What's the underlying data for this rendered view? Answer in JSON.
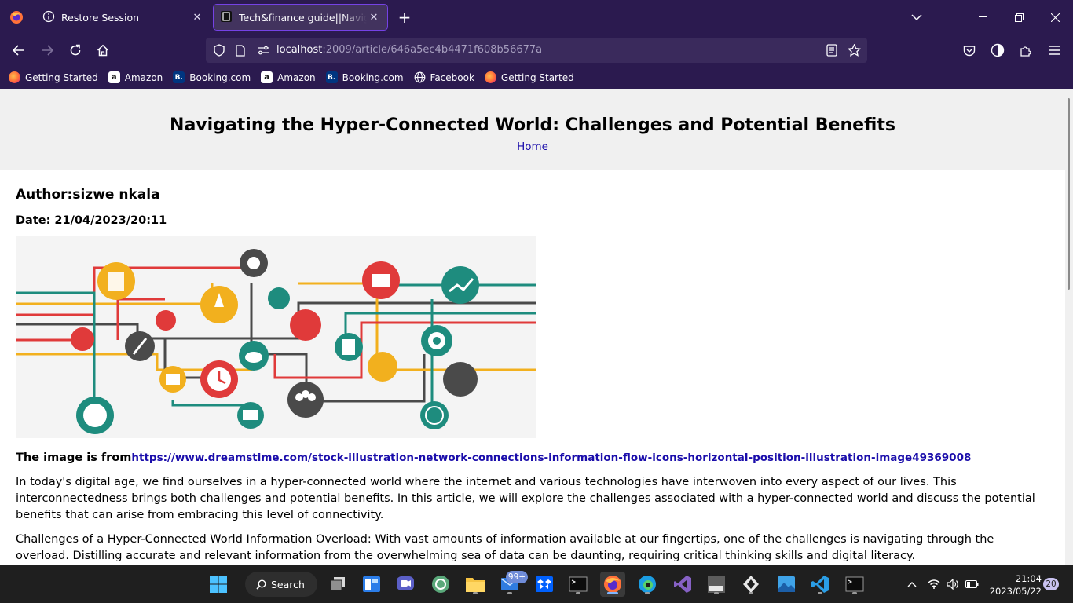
{
  "browser": {
    "tabs": [
      {
        "label": "Restore Session",
        "icon": "info-icon"
      },
      {
        "label": "Tech&finance guide||Navigating the Hyper-Connected World",
        "icon": "page-favicon-icon",
        "active": true
      }
    ],
    "url": {
      "host": "localhost",
      "rest": ":2009/article/646a5ec4b4471f608b56677a"
    },
    "bookmarks": [
      {
        "label": "Getting Started",
        "icon": "firefox-icon"
      },
      {
        "label": "Amazon",
        "icon": "amazon-icon"
      },
      {
        "label": "Booking.com",
        "icon": "booking-icon"
      },
      {
        "label": "Amazon",
        "icon": "amazon-icon"
      },
      {
        "label": "Booking.com",
        "icon": "booking-icon"
      },
      {
        "label": "Facebook",
        "icon": "globe-icon"
      },
      {
        "label": "Getting Started",
        "icon": "firefox-icon"
      }
    ],
    "accent_color": "#2b1a4f"
  },
  "article": {
    "title": "Navigating the Hyper-Connected World: Challenges and Potential Benefits",
    "home_link": "Home",
    "author": "Author:sizwe nkala",
    "date": "Date: 21/04/2023/20:11",
    "image_source_label": "The image is from",
    "image_source_url": "https://www.dreamstime.com/stock-illustration-network-connections-information-flow-icons-horizontal-position-illustration-image49369008",
    "paragraphs": [
      "In today's digital age, we find ourselves in a hyper-connected world where the internet and various technologies have interwoven into every aspect of our lives. This interconnectedness brings both challenges and potential benefits. In this article, we will explore the challenges associated with a hyper-connected world and discuss the potential benefits that can arise from embracing this level of connectivity.",
      "Challenges of a Hyper-Connected World Information Overload: With vast amounts of information available at our fingertips, one of the challenges is navigating through the overload. Distilling accurate and relevant information from the overwhelming sea of data can be daunting, requiring critical thinking skills and digital literacy."
    ]
  },
  "taskbar": {
    "search_label": "Search",
    "mail_badge": "99+",
    "time": "21:04",
    "date": "2023/05/22",
    "notification_count": "20"
  }
}
